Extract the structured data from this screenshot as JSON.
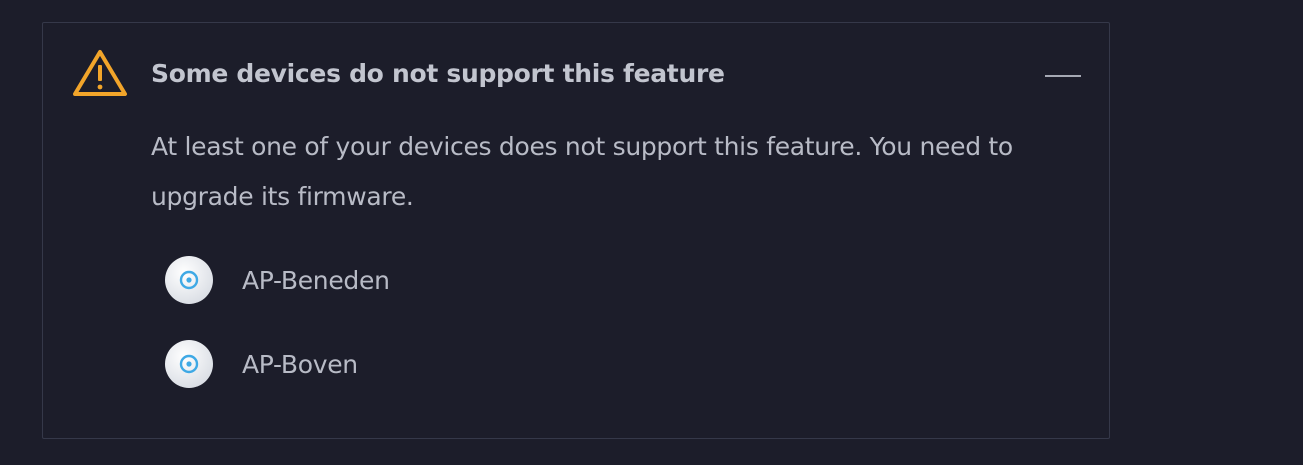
{
  "notice": {
    "title": "Some devices do not support this feature",
    "message": "At least one of your devices does not support this feature. You need to upgrade its firmware.",
    "icon": "warning-triangle-icon",
    "icon_color": "#f2a52a",
    "collapse_icon": "minus-icon"
  },
  "devices": [
    {
      "name": "AP-Beneden",
      "icon": "access-point-icon"
    },
    {
      "name": "AP-Boven",
      "icon": "access-point-icon"
    }
  ]
}
